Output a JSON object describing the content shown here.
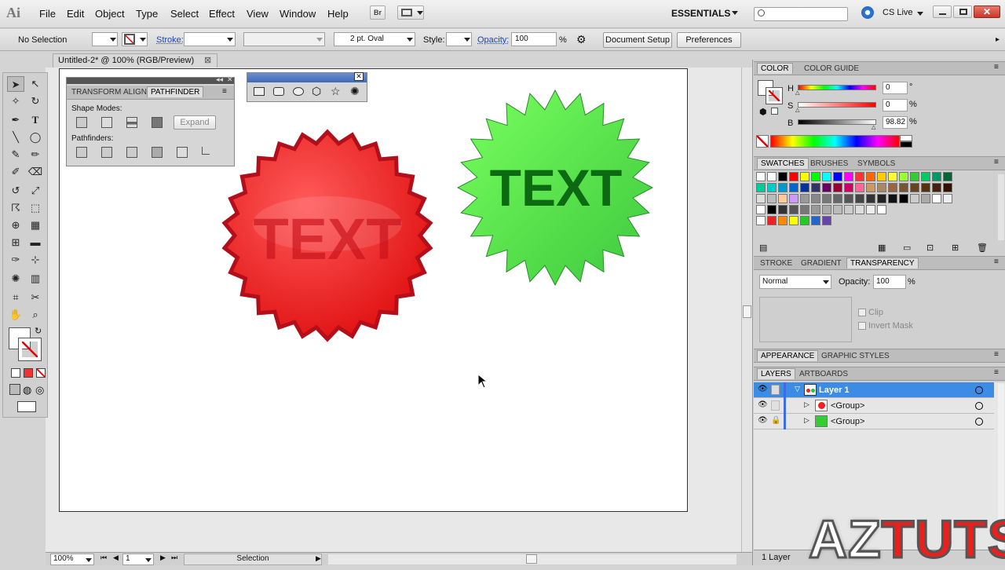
{
  "app": {
    "logo": "Ai"
  },
  "menu": [
    "File",
    "Edit",
    "Object",
    "Type",
    "Select",
    "Effect",
    "View",
    "Window",
    "Help"
  ],
  "bridge_button": "Br",
  "workspace": "ESSENTIALS",
  "cs_live": "CS Live",
  "search": {
    "placeholder": ""
  },
  "control_bar": {
    "selection": "No Selection",
    "stroke_label": "Stroke:",
    "brush": "2 pt. Oval",
    "style_label": "Style:",
    "opacity_label": "Opacity:",
    "opacity_value": "100",
    "opacity_unit": "%",
    "document_setup": "Document Setup",
    "preferences": "Preferences"
  },
  "document": {
    "tab_title": "Untitled-2* @ 100% (RGB/Preview)"
  },
  "artwork": {
    "red_text": "TEXT",
    "green_text": "TEXT"
  },
  "pathfinder": {
    "tabs": [
      "TRANSFORM",
      "ALIGN",
      "PATHFINDER"
    ],
    "shape_modes": "Shape Modes:",
    "expand": "Expand",
    "pathfinders": "Pathfinders:"
  },
  "color": {
    "tabs": [
      "COLOR",
      "COLOR GUIDE"
    ],
    "h_label": "H",
    "h_value": "0",
    "h_unit": "°",
    "s_label": "S",
    "s_value": "0",
    "s_unit": "%",
    "b_label": "B",
    "b_value": "98.82",
    "b_unit": "%"
  },
  "swatches": {
    "tabs": [
      "SWATCHES",
      "BRUSHES",
      "SYMBOLS"
    ]
  },
  "transparency": {
    "tabs": [
      "STROKE",
      "GRADIENT",
      "TRANSPARENCY"
    ],
    "mode": "Normal",
    "opacity_label": "Opacity:",
    "opacity_value": "100",
    "opacity_unit": "%",
    "clip": "Clip",
    "invert_mask": "Invert Mask"
  },
  "appearance": {
    "tabs": [
      "APPEARANCE",
      "GRAPHIC STYLES"
    ]
  },
  "layers": {
    "tabs": [
      "LAYERS",
      "ARTBOARDS"
    ],
    "rows": [
      {
        "name": "Layer 1"
      },
      {
        "name": "<Group>"
      },
      {
        "name": "<Group>"
      }
    ],
    "count": "1 Layer"
  },
  "status": {
    "zoom": "100%",
    "artboard": "1",
    "tool": "Selection"
  },
  "watermark": {
    "part1": "AZ",
    "part2": "TUTS"
  },
  "colors": {
    "red": "#ff2a2a",
    "green": "#55e055",
    "selection_blue": "#3c8ce6"
  }
}
